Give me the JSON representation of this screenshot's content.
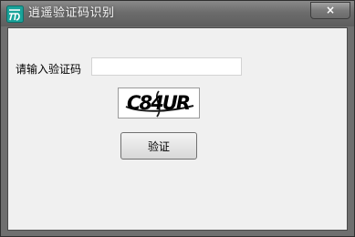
{
  "window": {
    "title": "逍遥验证码识别",
    "close_label": "×"
  },
  "form": {
    "label": "请输入验证码",
    "input_value": "",
    "input_placeholder": "",
    "captcha_text": "C84UR",
    "button_label": "验证"
  },
  "icons": {
    "app": "app-logo-icon",
    "close": "close-icon"
  },
  "colors": {
    "titlebar": "#6c6c6c",
    "client_bg": "#f0f0f0",
    "captcha_text": "#000000"
  }
}
